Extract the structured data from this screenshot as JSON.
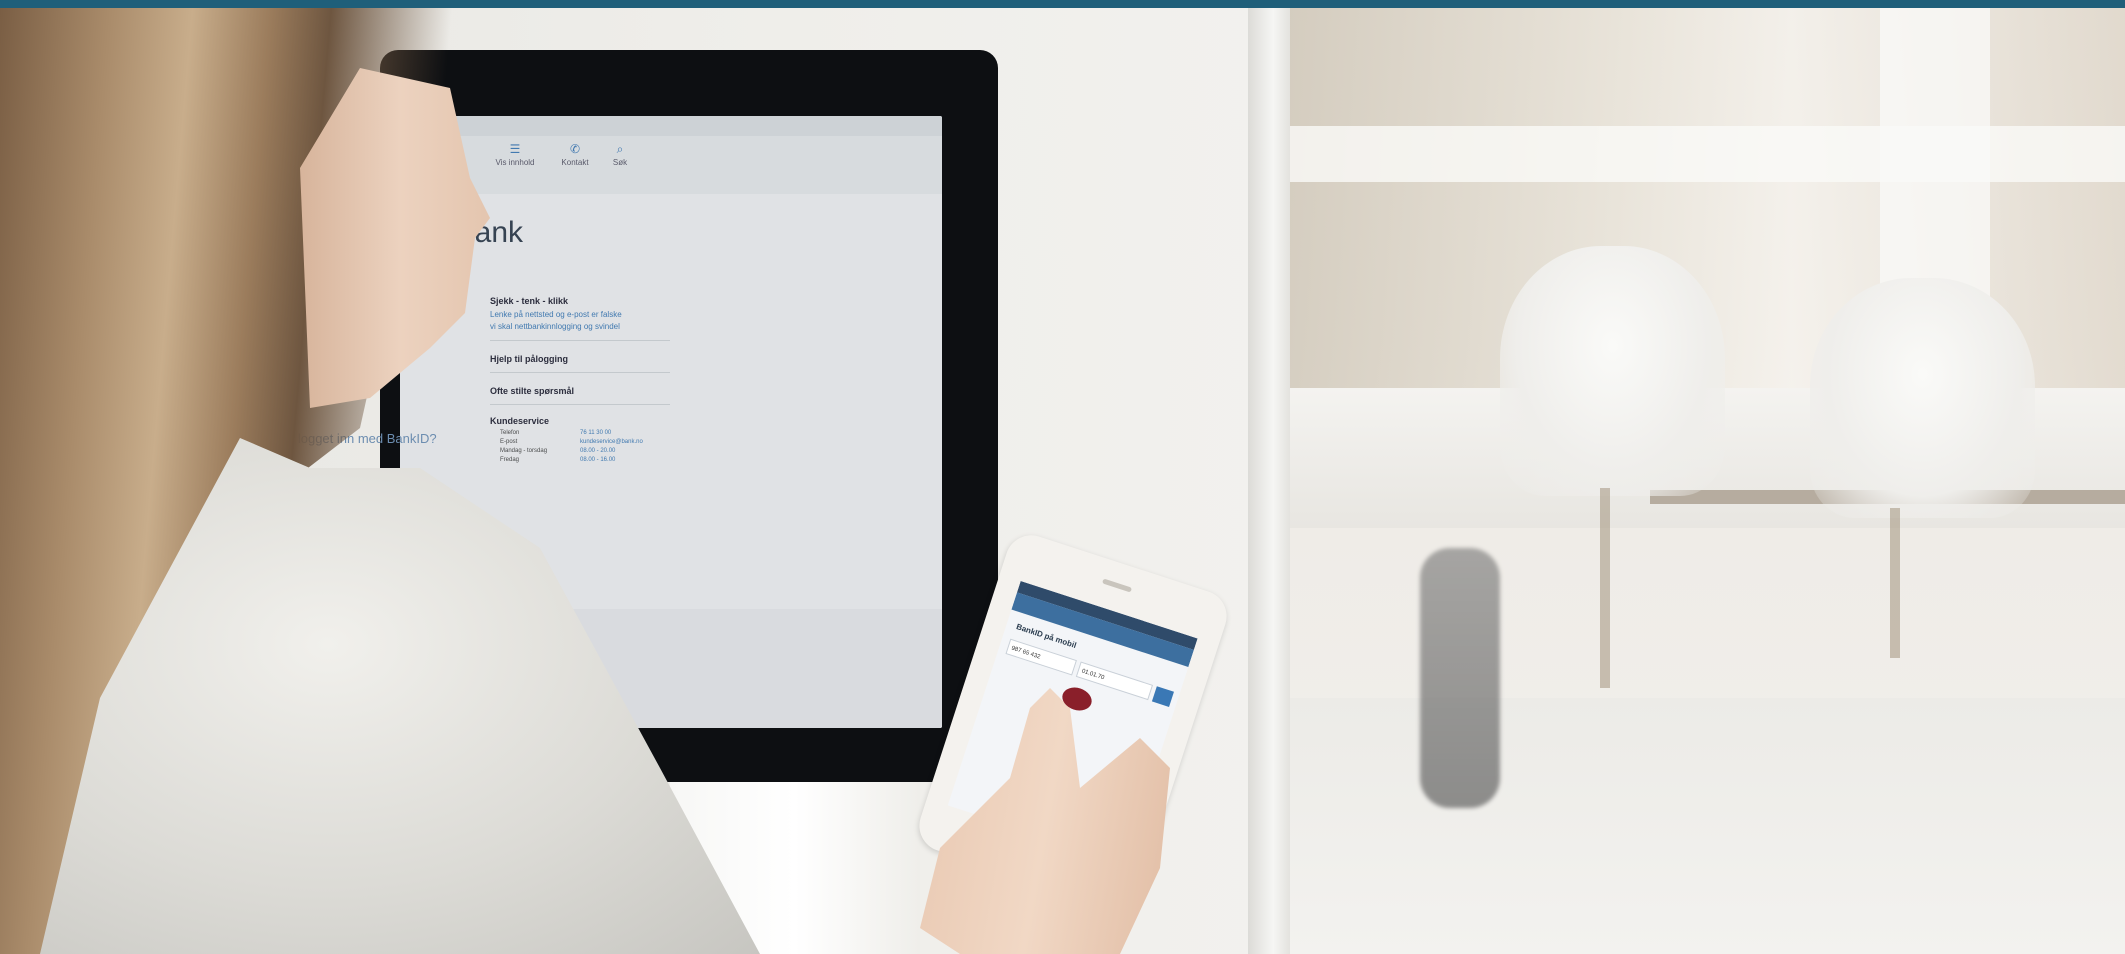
{
  "monitor_screen": {
    "nav": [
      {
        "icon": "☰",
        "label": "Vis innhold"
      },
      {
        "icon": "✆",
        "label": "Kontakt"
      },
      {
        "icon": "⌕",
        "label": "Søk"
      }
    ],
    "heading": "bank",
    "sections": [
      {
        "title": "Sjekk - tenk - klikk",
        "links": [
          "Lenke på nettsted og e-post er falske",
          "vi skal nettbankinnlogging og svindel"
        ]
      },
      {
        "title": "Hjelp til pålogging"
      },
      {
        "title": "Ofte stilte spørsmål"
      },
      {
        "title": "Kundeservice"
      }
    ],
    "contact_rows": [
      {
        "label": "Telefon",
        "value": "76 11 30 00"
      },
      {
        "label": "E-post",
        "value": "kundeservice@bank.no"
      },
      {
        "label": "Mandag - torsdag",
        "value": "08.00 - 20.00"
      },
      {
        "label": "Fredag",
        "value": "08.00 - 16.00"
      }
    ],
    "help_link": "Får ikke logget inn med BankID?"
  },
  "phone_screen": {
    "title": "BankID på mobil",
    "fields": [
      "987 65 432",
      "01.01.70"
    ]
  }
}
